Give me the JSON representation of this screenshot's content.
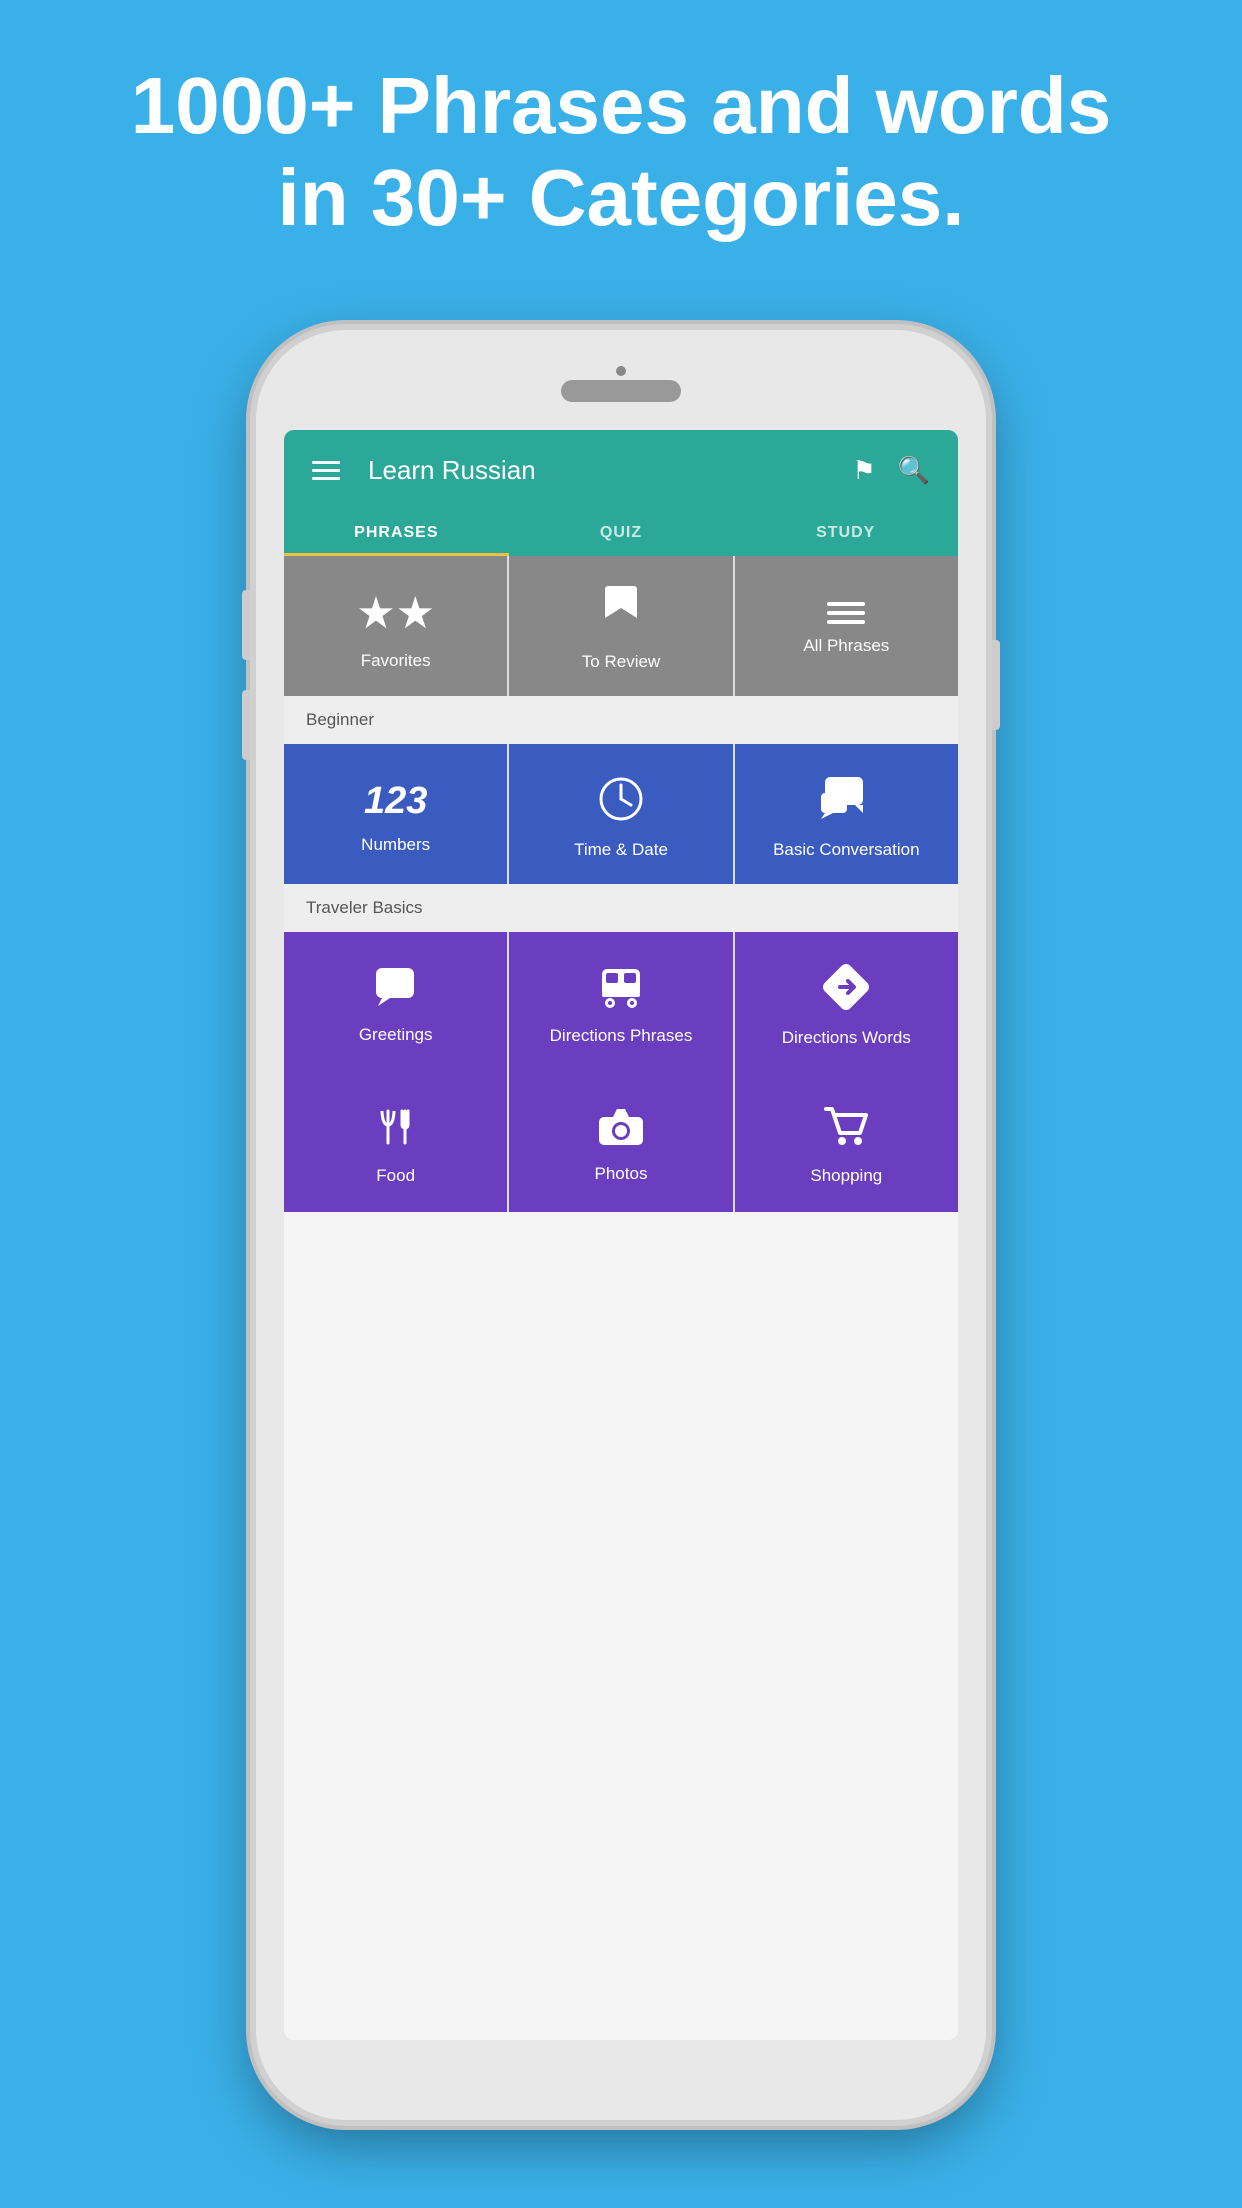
{
  "header": {
    "tagline_line1": "1000+ Phrases and words",
    "tagline_line2": "in 30+ Categories."
  },
  "app": {
    "title": "Learn Russian",
    "tabs": [
      {
        "id": "phrases",
        "label": "PHRASES",
        "active": true
      },
      {
        "id": "quiz",
        "label": "QUIZ",
        "active": false
      },
      {
        "id": "study",
        "label": "STUDY",
        "active": false
      }
    ],
    "top_categories": [
      {
        "id": "favorites",
        "label": "Favorites",
        "icon": "star"
      },
      {
        "id": "to-review",
        "label": "To Review",
        "icon": "bookmark"
      },
      {
        "id": "all-phrases",
        "label": "All Phrases",
        "icon": "lines"
      }
    ],
    "section_beginner": "Beginner",
    "beginner_categories": [
      {
        "id": "numbers",
        "label": "Numbers",
        "icon": "123"
      },
      {
        "id": "time-date",
        "label": "Time & Date",
        "icon": "clock"
      },
      {
        "id": "basic-conversation",
        "label": "Basic Conversation",
        "icon": "chat"
      }
    ],
    "section_traveler": "Traveler Basics",
    "traveler_categories": [
      {
        "id": "greetings",
        "label": "Greetings",
        "icon": "speech"
      },
      {
        "id": "directions-phrases",
        "label": "Directions Phrases",
        "icon": "bus"
      },
      {
        "id": "directions-words",
        "label": "Directions Words",
        "icon": "direction"
      }
    ],
    "bottom_categories": [
      {
        "id": "food",
        "label": "Food",
        "icon": "utensils"
      },
      {
        "id": "photos",
        "label": "Photos",
        "icon": "camera"
      },
      {
        "id": "shopping",
        "label": "Shopping",
        "icon": "cart"
      }
    ]
  }
}
